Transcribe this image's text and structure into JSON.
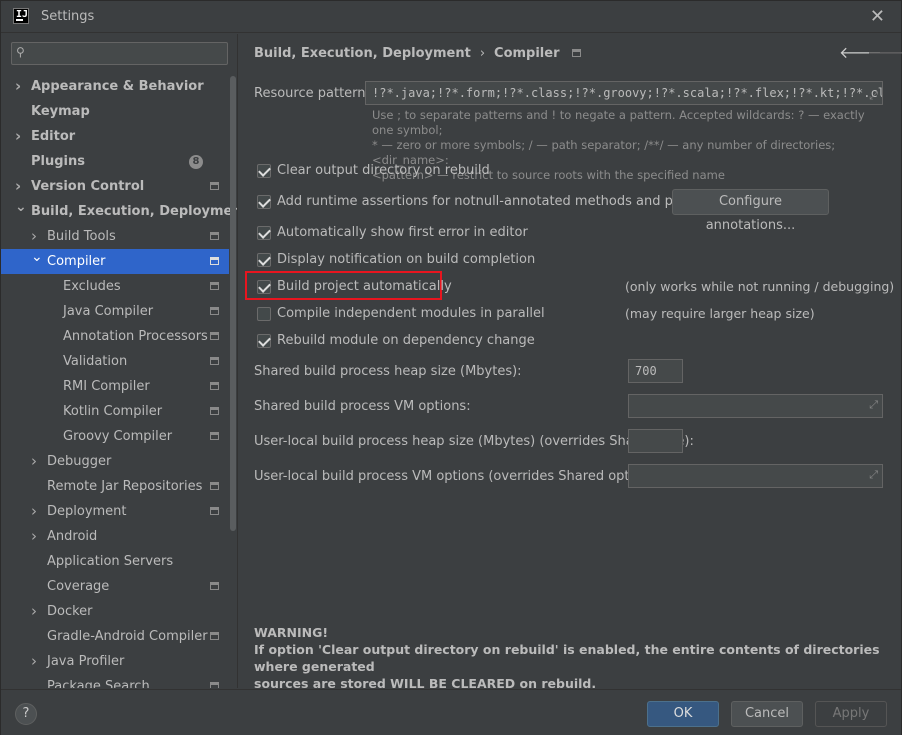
{
  "window": {
    "title": "Settings"
  },
  "search": {
    "placeholder": "",
    "value": ""
  },
  "sidebar": {
    "items": [
      {
        "label": "Appearance & Behavior",
        "level": 0,
        "arrow": "right",
        "bold": true,
        "project_icon": false
      },
      {
        "label": "Keymap",
        "level": 0,
        "arrow": "none",
        "bold": true,
        "project_icon": false
      },
      {
        "label": "Editor",
        "level": 0,
        "arrow": "right",
        "bold": true,
        "project_icon": false
      },
      {
        "label": "Plugins",
        "level": 0,
        "arrow": "none",
        "bold": true,
        "project_icon": false,
        "badge": "8"
      },
      {
        "label": "Version Control",
        "level": 0,
        "arrow": "right",
        "bold": true,
        "project_icon": true
      },
      {
        "label": "Build, Execution, Deployment",
        "level": 0,
        "arrow": "down",
        "bold": true,
        "project_icon": false
      },
      {
        "label": "Build Tools",
        "level": 1,
        "arrow": "right",
        "bold": false,
        "project_icon": true
      },
      {
        "label": "Compiler",
        "level": 1,
        "arrow": "down",
        "bold": false,
        "project_icon": true,
        "selected": true
      },
      {
        "label": "Excludes",
        "level": 2,
        "arrow": "none",
        "bold": false,
        "project_icon": true
      },
      {
        "label": "Java Compiler",
        "level": 2,
        "arrow": "none",
        "bold": false,
        "project_icon": true
      },
      {
        "label": "Annotation Processors",
        "level": 2,
        "arrow": "none",
        "bold": false,
        "project_icon": true
      },
      {
        "label": "Validation",
        "level": 2,
        "arrow": "none",
        "bold": false,
        "project_icon": true
      },
      {
        "label": "RMI Compiler",
        "level": 2,
        "arrow": "none",
        "bold": false,
        "project_icon": true
      },
      {
        "label": "Kotlin Compiler",
        "level": 2,
        "arrow": "none",
        "bold": false,
        "project_icon": true
      },
      {
        "label": "Groovy Compiler",
        "level": 2,
        "arrow": "none",
        "bold": false,
        "project_icon": true
      },
      {
        "label": "Debugger",
        "level": 1,
        "arrow": "right",
        "bold": false,
        "project_icon": false
      },
      {
        "label": "Remote Jar Repositories",
        "level": 1,
        "arrow": "none",
        "bold": false,
        "project_icon": true
      },
      {
        "label": "Deployment",
        "level": 1,
        "arrow": "right",
        "bold": false,
        "project_icon": true
      },
      {
        "label": "Android",
        "level": 1,
        "arrow": "right",
        "bold": false,
        "project_icon": false
      },
      {
        "label": "Application Servers",
        "level": 1,
        "arrow": "none",
        "bold": false,
        "project_icon": false
      },
      {
        "label": "Coverage",
        "level": 1,
        "arrow": "none",
        "bold": false,
        "project_icon": true
      },
      {
        "label": "Docker",
        "level": 1,
        "arrow": "right",
        "bold": false,
        "project_icon": false
      },
      {
        "label": "Gradle-Android Compiler",
        "level": 1,
        "arrow": "none",
        "bold": false,
        "project_icon": true
      },
      {
        "label": "Java Profiler",
        "level": 1,
        "arrow": "right",
        "bold": false,
        "project_icon": false
      },
      {
        "label": "Package Search",
        "level": 1,
        "arrow": "none",
        "bold": false,
        "project_icon": true
      }
    ]
  },
  "breadcrumb": {
    "parent": "Build, Execution, Deployment",
    "separator": "›",
    "current": "Compiler"
  },
  "nav": {
    "back_icon": "arrow-left-icon",
    "forward_icon": "arrow-right-icon"
  },
  "resource": {
    "label": "Resource patterns:",
    "value": "!?*.java;!?*.form;!?*.class;!?*.groovy;!?*.scala;!?*.flex;!?*.kt;!?*.clj;!?*.aj",
    "hint_line1": "Use ; to separate patterns and ! to negate a pattern. Accepted wildcards: ? — exactly one symbol;",
    "hint_line2": "* — zero or more symbols; / — path separator; /**/ — any number of directories; <dir_name>:",
    "hint_line3": "<pattern> — restrict to source roots with the specified name"
  },
  "options": {
    "clear_output": {
      "label": "Clear output directory on rebuild",
      "checked": true
    },
    "runtime_assertions": {
      "label": "Add runtime assertions for notnull-annotated methods and parameters",
      "checked": true
    },
    "configure_annotations": "Configure annotations...",
    "show_first_error": {
      "label": "Automatically show first error in editor",
      "checked": true
    },
    "display_notification": {
      "label": "Display notification on build completion",
      "checked": true
    },
    "build_automatically": {
      "label": "Build project automatically",
      "checked": true,
      "note": "(only works while not running / debugging)"
    },
    "compile_parallel": {
      "label": "Compile independent modules in parallel",
      "checked": false,
      "note": "(may require larger heap size)"
    },
    "rebuild_module": {
      "label": "Rebuild module on dependency change",
      "checked": true
    }
  },
  "heap": {
    "label": "Shared build process heap size (Mbytes):",
    "value": "700"
  },
  "vm_options": {
    "label": "Shared build process VM options:",
    "value": ""
  },
  "local_heap": {
    "label": "User-local build process heap size (Mbytes) (overrides Shared size):",
    "value": ""
  },
  "local_vm": {
    "label": "User-local build process VM options (overrides Shared options):",
    "value": ""
  },
  "warning": {
    "title": "WARNING!",
    "line1": "If option 'Clear output directory on rebuild' is enabled, the entire contents of directories where generated",
    "line2": "sources are stored WILL BE CLEARED on rebuild."
  },
  "buttons": {
    "help": "?",
    "ok": "OK",
    "cancel": "Cancel",
    "apply": "Apply"
  },
  "colors": {
    "background": "#3c3f41",
    "selection": "#2f65ca",
    "primary_button": "#365880",
    "highlight": "#e8151f"
  }
}
